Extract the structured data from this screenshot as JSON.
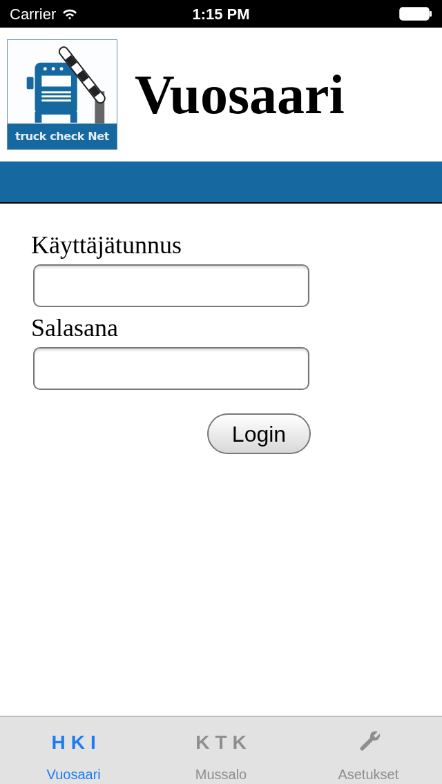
{
  "status_bar": {
    "carrier": "Carrier",
    "time": "1:15 PM"
  },
  "header": {
    "logo_text": "truck check Net",
    "title": "Vuosaari"
  },
  "form": {
    "fields": [
      {
        "label": "Käyttäjätunnus"
      },
      {
        "label": "Salasana"
      }
    ],
    "button": "Login"
  },
  "tab_bar": [
    {
      "kind": "text",
      "icon_text": "HKI",
      "label": "Vuosaari",
      "selected": true
    },
    {
      "kind": "text",
      "icon_text": "KTK",
      "label": "Mussalo",
      "selected": false
    },
    {
      "kind": "wrench",
      "label": "Asetukset",
      "selected": false
    }
  ]
}
